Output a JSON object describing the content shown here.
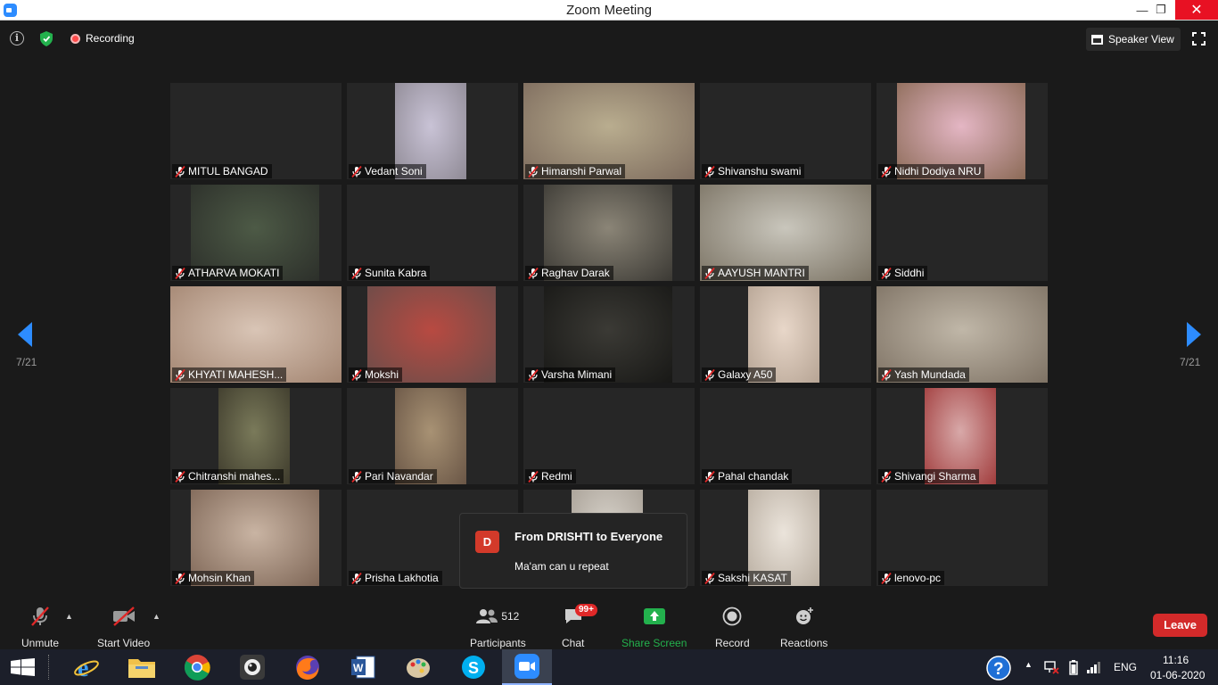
{
  "window": {
    "title": "Zoom Meeting"
  },
  "topbar": {
    "recording_label": "Recording",
    "speaker_view_label": "Speaker View"
  },
  "pagination": {
    "left": "7/21",
    "right": "7/21"
  },
  "participants": [
    {
      "name": "MITUL BANGAD",
      "video": null
    },
    {
      "name": "Vedant Soni",
      "video": {
        "start": 0.28,
        "width": 0.42,
        "colors": [
          "#c9c3d6",
          "#8f8a95"
        ]
      }
    },
    {
      "name": "Himanshi Parwal",
      "video": {
        "start": 0.0,
        "width": 1.0,
        "colors": [
          "#b9ad8f",
          "#7d6b5d"
        ]
      }
    },
    {
      "name": "Shivanshu swami",
      "video": null
    },
    {
      "name": "Nidhi Dodiya NRU",
      "video": {
        "start": 0.12,
        "width": 0.75,
        "colors": [
          "#e4b6c4",
          "#8b6a56"
        ]
      }
    },
    {
      "name": "ATHARVA MOKATI",
      "video": {
        "start": 0.12,
        "width": 0.75,
        "colors": [
          "#4d5a46",
          "#2c2f2a"
        ]
      }
    },
    {
      "name": "Sunita Kabra",
      "video": null
    },
    {
      "name": "Raghav Darak",
      "video": {
        "start": 0.12,
        "width": 0.75,
        "colors": [
          "#8b8577",
          "#3b3934"
        ]
      }
    },
    {
      "name": "AAYUSH MANTRI",
      "video": {
        "start": 0.0,
        "width": 1.0,
        "colors": [
          "#c9c6bc",
          "#7b7364"
        ]
      }
    },
    {
      "name": "Siddhi",
      "video": null
    },
    {
      "name": "KHYATI MAHESH...",
      "video": {
        "start": 0.0,
        "width": 1.0,
        "colors": [
          "#d9c5b6",
          "#a38571"
        ]
      }
    },
    {
      "name": "Mokshi",
      "video": {
        "start": 0.12,
        "width": 0.75,
        "colors": [
          "#b84a41",
          "#6a4d4a"
        ]
      }
    },
    {
      "name": "Varsha Mimani",
      "video": {
        "start": 0.12,
        "width": 0.75,
        "colors": [
          "#3b3a35",
          "#181816"
        ]
      }
    },
    {
      "name": "Galaxy A50",
      "video": {
        "start": 0.28,
        "width": 0.42,
        "colors": [
          "#e8d7c9",
          "#b6a494"
        ]
      }
    },
    {
      "name": "Yash Mundada",
      "video": {
        "start": 0.0,
        "width": 1.0,
        "colors": [
          "#c0b7a8",
          "#7e7264"
        ]
      }
    },
    {
      "name": "Chitranshi mahes...",
      "video": {
        "start": 0.28,
        "width": 0.42,
        "colors": [
          "#7a7a5a",
          "#3e3b2c"
        ]
      }
    },
    {
      "name": "Pari Navandar",
      "video": {
        "start": 0.28,
        "width": 0.42,
        "colors": [
          "#a89274",
          "#6a5646"
        ]
      }
    },
    {
      "name": "Redmi",
      "video": null
    },
    {
      "name": "Pahal chandak",
      "video": null
    },
    {
      "name": "Shivangi Sharma",
      "video": {
        "start": 0.28,
        "width": 0.42,
        "colors": [
          "#d8a9a9",
          "#a13c3c"
        ]
      }
    },
    {
      "name": "Mohsin Khan",
      "video": {
        "start": 0.12,
        "width": 0.75,
        "colors": [
          "#c9b4a3",
          "#7e6656"
        ]
      }
    },
    {
      "name": "Prisha Lakhotia",
      "video": null
    },
    {
      "name": "",
      "video": {
        "start": 0.28,
        "width": 0.42,
        "colors": [
          "#d9d4cc",
          "#a8a096"
        ]
      }
    },
    {
      "name": "Sakshi KASAT",
      "video": {
        "start": 0.28,
        "width": 0.42,
        "colors": [
          "#ebe4db",
          "#b9aea1"
        ]
      }
    },
    {
      "name": "lenovo-pc",
      "video": null
    }
  ],
  "chat_popup": {
    "avatar_letter": "D",
    "from": "From DRISHTI to Everyone",
    "message": "Ma'am can u repeat"
  },
  "toolbar": {
    "unmute": "Unmute",
    "start_video": "Start Video",
    "participants": "Participants",
    "participant_count": "512",
    "chat": "Chat",
    "chat_badge": "99+",
    "share_screen": "Share Screen",
    "record": "Record",
    "reactions": "Reactions",
    "leave": "Leave"
  },
  "taskbar": {
    "apps": [
      "internet-explorer-icon",
      "file-explorer-icon",
      "chrome-icon",
      "webcam-app-icon",
      "firefox-icon",
      "word-icon",
      "paint-icon",
      "skype-icon",
      "zoom-icon"
    ],
    "language": "ENG",
    "time": "11:16",
    "date": "01-06-2020"
  },
  "colors": {
    "accent": "#2d8cff",
    "share_green": "#23b14d",
    "leave_red": "#d32a2a",
    "badge_red": "#e02828"
  }
}
